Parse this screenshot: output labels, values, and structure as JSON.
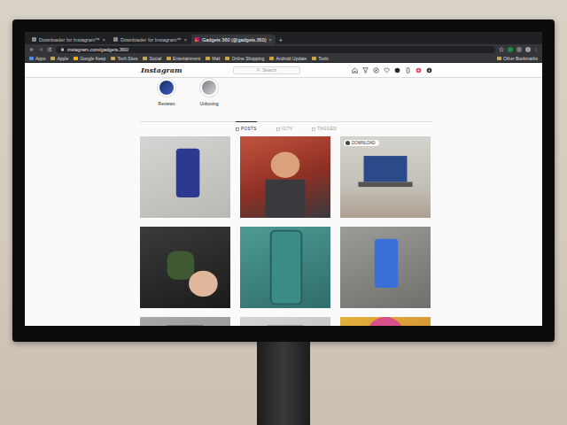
{
  "browser": {
    "tabs": [
      {
        "label": "Downloader for Instagram™",
        "close": "×",
        "selected": false
      },
      {
        "label": "Downloader for Instagram™",
        "close": "×",
        "selected": false
      },
      {
        "label": "Gadgets 360 (@gadgets.360)",
        "close": "×",
        "selected": true
      }
    ],
    "new_tab": "+",
    "address": "instagram.com/gadgets.360/",
    "bookmarks": [
      "Apps",
      "Apple",
      "Google Keep",
      "Tech Sites",
      "Social",
      "Entertainment",
      "Mail",
      "Online Shopping",
      "Android Update",
      "Tools"
    ],
    "other_bookmarks": "Other Bookmarks"
  },
  "instagram": {
    "logo": "Instagram",
    "search": {
      "placeholder": "Search"
    },
    "highlights": [
      {
        "label": "Reviews"
      },
      {
        "label": "Unboxing"
      }
    ],
    "tabs": [
      {
        "label": "POSTS",
        "selected": true
      },
      {
        "label": "IGTV",
        "selected": false
      },
      {
        "label": "TAGGED",
        "selected": false
      }
    ],
    "download_label": "DOWNLOAD",
    "posts": [
      {
        "hovered": false
      },
      {
        "hovered": false
      },
      {
        "hovered": true
      },
      {
        "hovered": false
      },
      {
        "hovered": false
      },
      {
        "hovered": false
      },
      {
        "hovered": false
      },
      {
        "hovered": false
      },
      {
        "hovered": false
      }
    ]
  }
}
